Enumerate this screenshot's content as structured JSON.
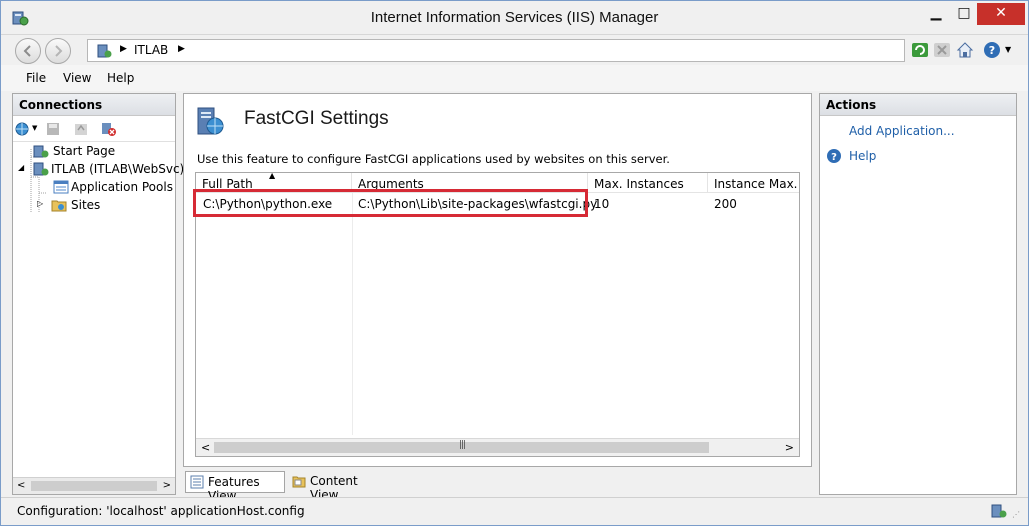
{
  "window": {
    "title": "Internet Information Services (IIS) Manager",
    "minimize": "▁",
    "maximize": "□",
    "close": "✕"
  },
  "address": {
    "path_item": "ITLAB",
    "separator": "▶"
  },
  "menu": {
    "file": "File",
    "view": "View",
    "help": "Help"
  },
  "connections": {
    "header": "Connections",
    "tree": [
      {
        "label": "Start Page"
      },
      {
        "label": "ITLAB (ITLAB\\WebSvc)"
      },
      {
        "label": "Application Pools"
      },
      {
        "label": "Sites"
      }
    ]
  },
  "feature": {
    "title": "FastCGI Settings",
    "description": "Use this feature to configure FastCGI applications used by websites on this server.",
    "columns": [
      "Full Path",
      "Arguments",
      "Max. Instances",
      "Instance Max. Re"
    ],
    "rows": [
      {
        "full_path": "C:\\Python\\python.exe",
        "arguments": "C:\\Python\\Lib\\site-packages\\wfastcgi.py",
        "max_instances": "10",
        "instance_max_requests": "200"
      }
    ],
    "sort_indicator": "▲",
    "scroll_grip": "|||"
  },
  "viewbar": {
    "features_view": "Features View",
    "content_view": "Content View"
  },
  "actions": {
    "header": "Actions",
    "add_application": "Add Application...",
    "help": "Help"
  },
  "status": {
    "text": "Configuration: 'localhost' applicationHost.config"
  },
  "colors": {
    "highlight": "#d62a35",
    "link": "#1f5fa8",
    "close": "#c7302a"
  }
}
